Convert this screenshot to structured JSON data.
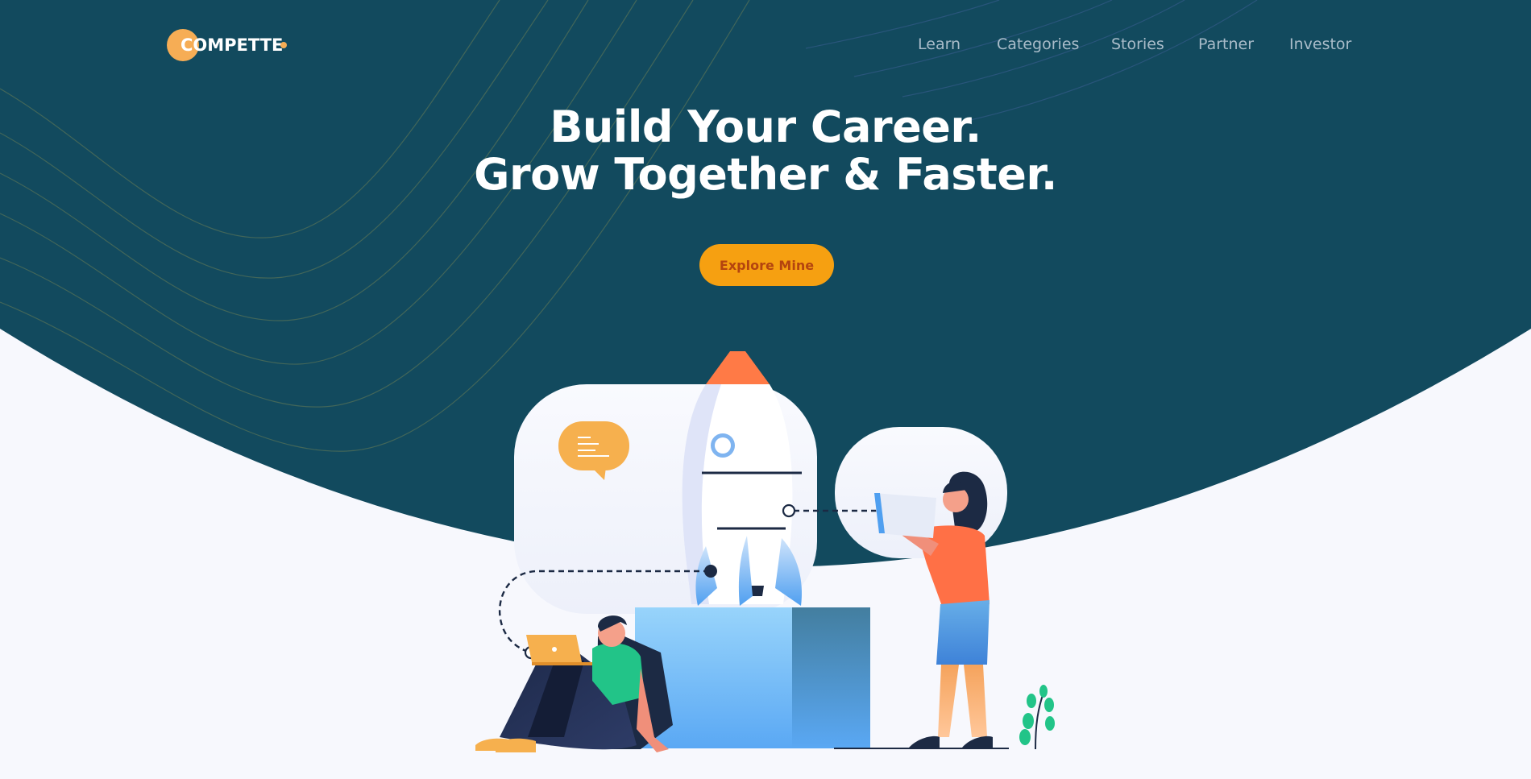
{
  "brand": {
    "name": "COMPETTE",
    "colors": {
      "navy": "#124a5e",
      "accent_orange": "#f6ad55",
      "cta": "#f6a011",
      "cta_text": "#b4440f",
      "nav_text": "#a9bcc9",
      "page_bg": "#f7f8fd"
    }
  },
  "nav": {
    "items": [
      {
        "label": "Learn"
      },
      {
        "label": "Categories"
      },
      {
        "label": "Stories"
      },
      {
        "label": "Partner"
      },
      {
        "label": "Investor"
      }
    ]
  },
  "hero": {
    "headline_line1": "Build Your Career.",
    "headline_line2": "Grow Together & Faster.",
    "cta_label": "Explore Mine"
  },
  "illustration": {
    "subjects": [
      "rocket-icon",
      "chat-bubble-icon",
      "person-with-laptop",
      "person-with-tablet",
      "plant-icon",
      "pedestal-box"
    ]
  }
}
